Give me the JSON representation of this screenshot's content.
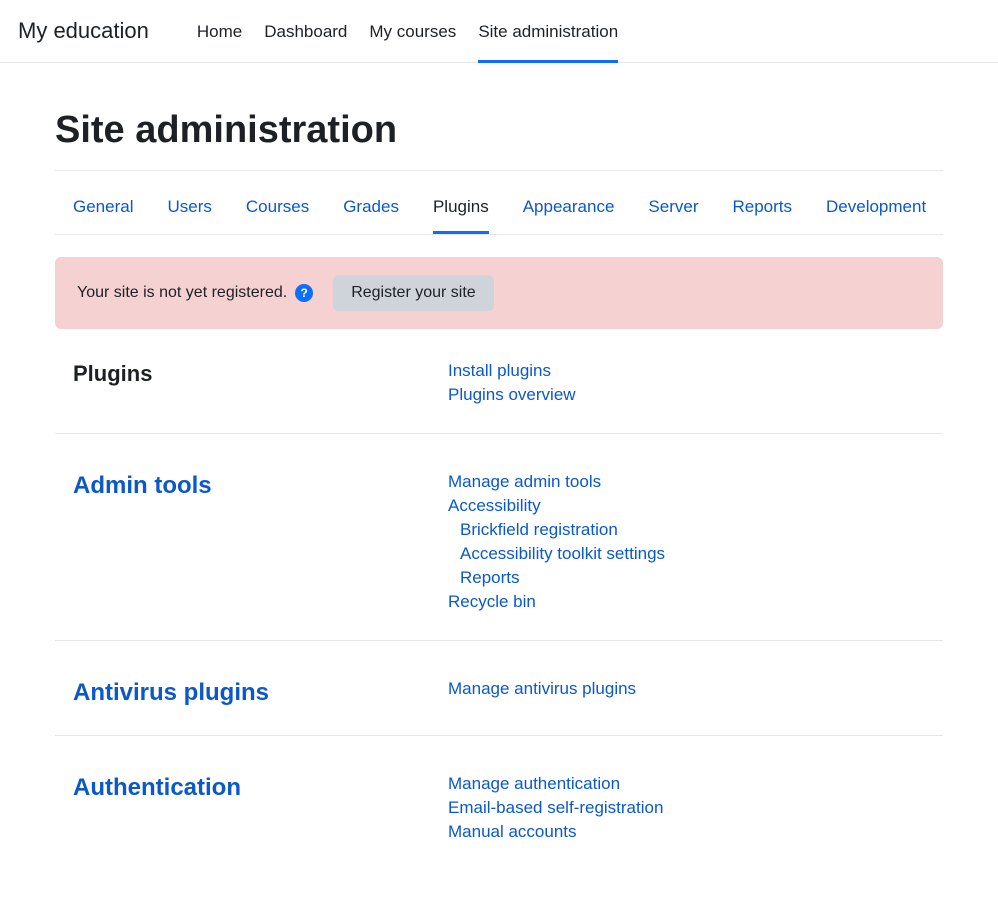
{
  "brand": "My education",
  "nav": {
    "items": [
      {
        "label": "Home",
        "active": false
      },
      {
        "label": "Dashboard",
        "active": false
      },
      {
        "label": "My courses",
        "active": false
      },
      {
        "label": "Site administration",
        "active": true
      }
    ]
  },
  "page_title": "Site administration",
  "tabs": [
    {
      "label": "General",
      "active": false
    },
    {
      "label": "Users",
      "active": false
    },
    {
      "label": "Courses",
      "active": false
    },
    {
      "label": "Grades",
      "active": false
    },
    {
      "label": "Plugins",
      "active": true
    },
    {
      "label": "Appearance",
      "active": false
    },
    {
      "label": "Server",
      "active": false
    },
    {
      "label": "Reports",
      "active": false
    },
    {
      "label": "Development",
      "active": false
    }
  ],
  "alert": {
    "text": "Your site is not yet registered.",
    "help_glyph": "?",
    "button": "Register your site"
  },
  "sections": [
    {
      "title": "Plugins",
      "title_is_link": false,
      "links": [
        {
          "label": "Install plugins"
        },
        {
          "label": "Plugins overview"
        }
      ]
    },
    {
      "title": "Admin tools",
      "title_is_link": true,
      "links": [
        {
          "label": "Manage admin tools"
        },
        {
          "label": "Accessibility",
          "is_group": true
        },
        {
          "label": "Brickfield registration",
          "indent": true
        },
        {
          "label": "Accessibility toolkit settings",
          "indent": true
        },
        {
          "label": "Reports",
          "indent": true
        },
        {
          "label": "Recycle bin"
        }
      ]
    },
    {
      "title": "Antivirus plugins",
      "title_is_link": true,
      "links": [
        {
          "label": "Manage antivirus plugins"
        }
      ]
    },
    {
      "title": "Authentication",
      "title_is_link": true,
      "links": [
        {
          "label": "Manage authentication"
        },
        {
          "label": "Email-based self-registration"
        },
        {
          "label": "Manual accounts"
        }
      ]
    }
  ]
}
